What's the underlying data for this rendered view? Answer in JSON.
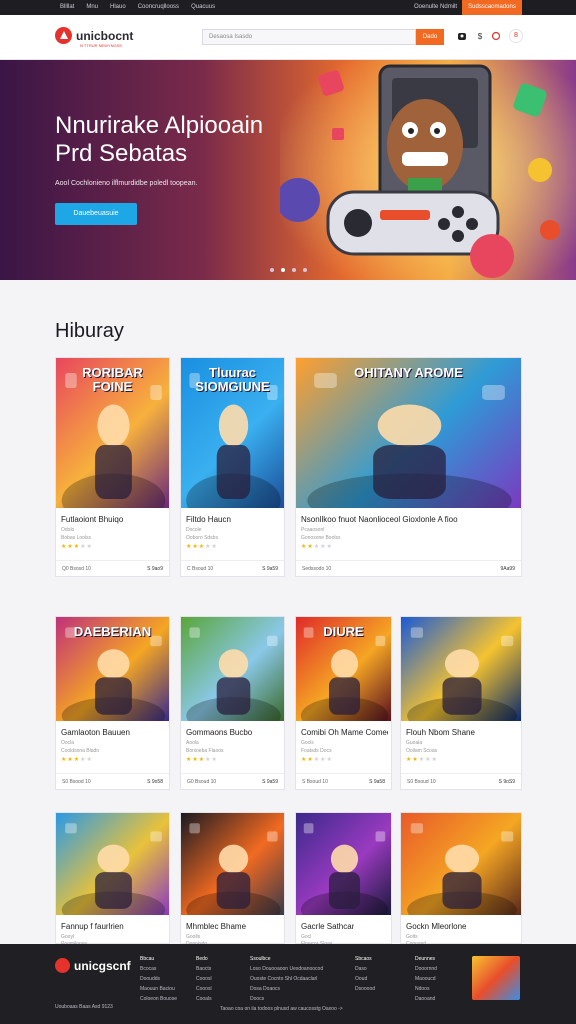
{
  "topbar": {
    "nav": [
      "Bllllat",
      "Mnu",
      "Hlauo",
      "Cooncruqllooss",
      "Quacuus"
    ],
    "login": "Ooenulte Ndmilt",
    "cta": "Sudsscaomadons"
  },
  "header": {
    "logo": "unicbocnt",
    "tagline": "N TTRUR NEWYNGSS",
    "search_placeholder": "Desaosa Isasdo",
    "search_button": "Dado",
    "cart_count": "8"
  },
  "hero": {
    "title_line1": "Nnurirake Alpiooain",
    "title_line2": "Prd Sebatas",
    "subtitle": "Aool Cochlonieno ilflmurdidbe poledl toopean.",
    "button": "Dauebeuasuie",
    "slides": 4
  },
  "section": {
    "title": "Hiburay"
  },
  "cards": [
    {
      "name": "Futlaoiont Bhuiqo",
      "meta": "Odolo",
      "meta2": "Bobas Loolss",
      "rating": 3,
      "foot_left": "Q0 Bsosd 10",
      "foot_right": "S 9ao9",
      "thumb_text": "RORIBAR FOINE",
      "colors": [
        "#e8465e",
        "#f7b13c",
        "#6b2a7a"
      ]
    },
    {
      "name": "Filtdo Haucn",
      "meta": "Docole",
      "meta2": "Ooboro Sdsbs",
      "rating": 3,
      "foot_left": "C Bsoud 10",
      "foot_right": "S 9a59",
      "thumb_text": "Tluurac SIOMGIUNE",
      "colors": [
        "#1a8fe0",
        "#3ab0f0",
        "#1b4e9a"
      ]
    },
    {
      "name": "Nsonllkoo fnuot Naonlioceol Gioxlonle A fioo",
      "meta": "Pcaaosonl",
      "meta2": "Gonosone Boolss",
      "rating": 2,
      "foot_left": "Sedssodo 10",
      "foot_right": "9Aa99",
      "thumb_text": "OHITANY AROME",
      "colors": [
        "#ff9f2e",
        "#2e9bd6",
        "#7a3ac0"
      ]
    },
    {
      "name": "Gamlaoton Bauuen",
      "meta": "Oocla",
      "meta2": "Cooldsona Blado",
      "rating": 3,
      "foot_left": "S0 Bsood 10",
      "foot_right": "S 9o58",
      "thumb_text": "DAEBERIAN",
      "colors": [
        "#c0307a",
        "#f5a623",
        "#3a2a8a"
      ]
    },
    {
      "name": "Gommaons Bucbo",
      "meta": "Aoola",
      "meta2": "Bonioeba Flaoos",
      "rating": 3,
      "foot_left": "G0 Bsoud 10",
      "foot_right": "S 9a59",
      "thumb_text": "",
      "colors": [
        "#5aa63a",
        "#8ac8e8",
        "#3a6a2a"
      ]
    },
    {
      "name": "Comibi Oh Mame Comee",
      "meta": "Gocls",
      "meta2": "Foatsds Docs",
      "rating": 2,
      "foot_left": "S Bsoud 10",
      "foot_right": "S 9a58",
      "thumb_text": "DIURE",
      "colors": [
        "#e02a2a",
        "#f5a623",
        "#5a1020"
      ]
    },
    {
      "name": "Flouh Nbom Shane",
      "meta": "Guoala",
      "meta2": "Oollam Scoas",
      "rating": 2,
      "foot_left": "S0 Bsoud 10",
      "foot_right": "S 9oS9",
      "thumb_text": "",
      "colors": [
        "#1a5ad6",
        "#f5c330",
        "#0a2a6a"
      ]
    },
    {
      "name": "Fannup f faurlrien",
      "meta": "Gooyl",
      "meta2": "Poomilonas",
      "rating": 3,
      "foot_left": "",
      "foot_right": "",
      "thumb_text": "",
      "colors": [
        "#2a9ae6",
        "#e8c23a",
        "#8a3ac0"
      ]
    },
    {
      "name": "Mhmblec Bhame",
      "meta": "Goolls",
      "meta2": "Donnisdo",
      "rating": 3,
      "foot_left": "",
      "foot_right": "",
      "thumb_text": "",
      "colors": [
        "#1a1a22",
        "#f26a21",
        "#3a3a4a"
      ]
    },
    {
      "name": "Gacrle Sathcar",
      "meta": "Gocl",
      "meta2": "Flowcor Sloas",
      "rating": 3,
      "foot_left": "",
      "foot_right": "",
      "thumb_text": "",
      "colors": [
        "#3a2a8a",
        "#9a3ac0",
        "#1a1a3a"
      ]
    },
    {
      "name": "Gockn Mleorlone",
      "meta": "Golts",
      "meta2": "Coonsnd",
      "rating": 3,
      "foot_left": "",
      "foot_right": "",
      "thumb_text": "",
      "colors": [
        "#e85a2a",
        "#f5a623",
        "#5a2a1a"
      ]
    }
  ],
  "footer": {
    "logo": "unicgscnf",
    "cols": [
      [
        "Bbcau",
        "Bcocas",
        "Dooudds",
        "Maouun Baciou",
        "Coloeon Bouose"
      ],
      [
        "Bedo",
        "Baocts",
        "Cooosl",
        "Cooosl",
        "Cooals"
      ],
      [
        "Ssoulbce",
        "Loso Douooaoon Uesdoanoocod",
        "Ouoste Cocnto Shl Ocdaaclarl",
        "Dosa Doaocs",
        "Doocs"
      ],
      [
        "Sbcaos",
        "Daso",
        "Ooud",
        "Dsooood"
      ],
      [
        "Deunnes",
        "Dooornnd",
        "Maooucd",
        "Ndoos",
        "Daooand"
      ]
    ],
    "copyright": "Uouboaas Baas Asd 9123",
    "terms": "Taoao coa on ila todoos plnusd aw caucosstg Oaxoo ->"
  }
}
